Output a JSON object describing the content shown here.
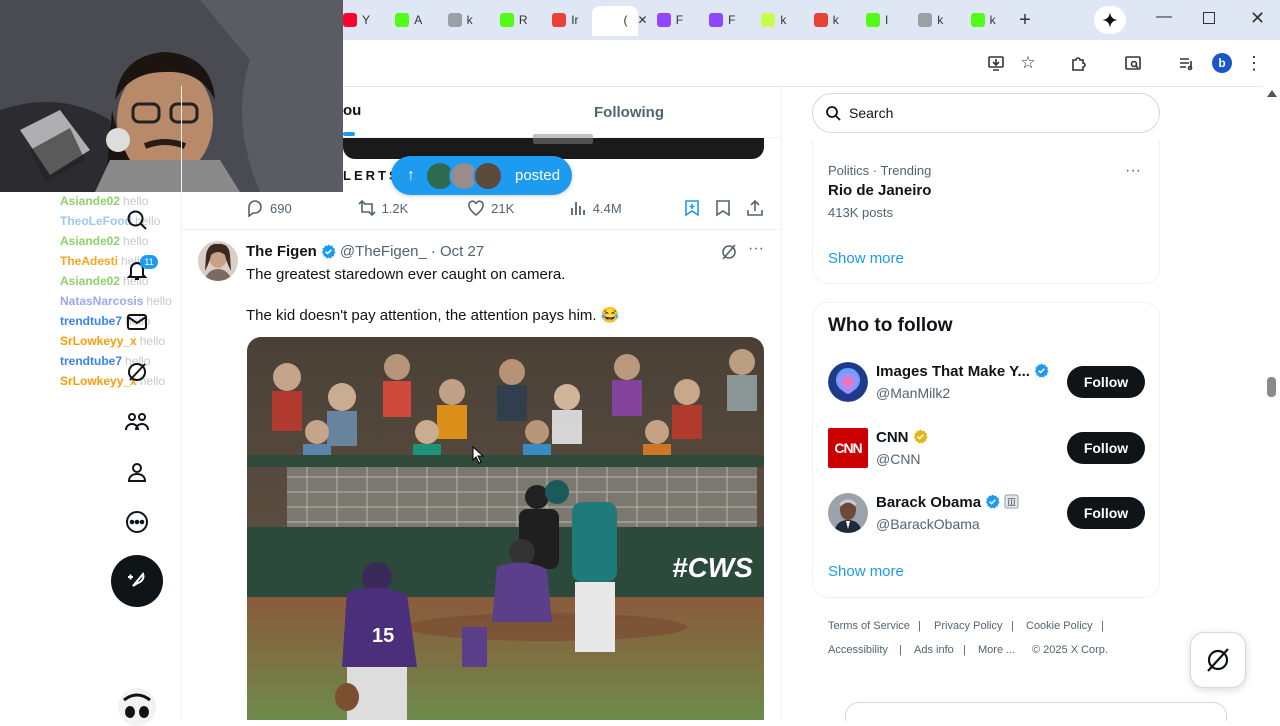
{
  "browser": {
    "tabs": [
      {
        "label": "Y",
        "color": "#ff0033"
      },
      {
        "label": "A",
        "color": "#53fc18"
      },
      {
        "label": "k",
        "color": "#9aa0a6"
      },
      {
        "label": "R",
        "color": "#53fc18"
      },
      {
        "label": "Ir",
        "color": "#ea4335"
      },
      {
        "label": "(",
        "color": "#ffffff"
      },
      {
        "label": "F",
        "color": "#9146ff"
      },
      {
        "label": "F",
        "color": "#9146ff"
      },
      {
        "label": "k",
        "color": "#c6ff4a"
      },
      {
        "label": "k",
        "color": "#ea4335"
      },
      {
        "label": "I",
        "color": "#53fc18"
      },
      {
        "label": "k",
        "color": "#9aa0a6"
      },
      {
        "label": "k",
        "color": "#53fc18"
      }
    ],
    "profile_initial": "b"
  },
  "chat": [
    {
      "user": "Asiande02",
      "color": "#8fd36b",
      "msg": "hello"
    },
    {
      "user": "TheoLeFood",
      "color": "#9fc6f5",
      "msg": "hello"
    },
    {
      "user": "Asiande02",
      "color": "#8fd36b",
      "msg": "hello"
    },
    {
      "user": "TheAdesti",
      "color": "#f5a623",
      "msg": "hello"
    },
    {
      "user": "Asiande02",
      "color": "#8fd36b",
      "msg": "hello"
    },
    {
      "user": "NatasNarcosis",
      "color": "#9fa7e8",
      "msg": "hello"
    },
    {
      "user": "trendtube7",
      "color": "#3b82f6",
      "msg": "hello"
    },
    {
      "user": "SrLowkeyy_x",
      "color": "#f59e0b",
      "msg": "hello"
    },
    {
      "user": "trendtube7",
      "color": "#3b82f6",
      "msg": "hello"
    },
    {
      "user": "SrLowkeyy_x",
      "color": "#f59e0b",
      "msg": "hello"
    }
  ],
  "sidebar": {
    "notif_count": "11"
  },
  "feed": {
    "tab_for_you": "ou",
    "tab_following": "Following",
    "alerts_fragment": "LERTS",
    "posted_pill": "posted"
  },
  "prev_tweet": {
    "replies": "690",
    "reposts": "1.2K",
    "likes": "21K",
    "views": "4.4M"
  },
  "tweet": {
    "name": "The Figen",
    "handle": "@TheFigen_",
    "date": "· Oct 27",
    "line1": "The greatest staredown ever caught on camera.",
    "line2": "The kid doesn't pay attention, the attention pays him. 😂",
    "media_overlay": "#CWS",
    "jersey": "15"
  },
  "right": {
    "search_placeholder": "Search",
    "trend": {
      "category": "Politics · Trending",
      "topic": "Rio de Janeiro",
      "posts": "413K posts"
    },
    "show_more": "Show more",
    "wtf_title": "Who to follow",
    "wtf": [
      {
        "name": "Images That Make Y...",
        "handle": "@ManMilk2",
        "follow": "Follow"
      },
      {
        "name": "CNN",
        "handle": "@CNN",
        "follow": "Follow",
        "logo": "CNN"
      },
      {
        "name": "Barack Obama",
        "handle": "@BarackObama",
        "follow": "Follow"
      }
    ],
    "wtf_show_more": "Show more",
    "footer": {
      "terms": "Terms of Service",
      "privacy": "Privacy Policy",
      "cookie": "Cookie Policy",
      "accessibility": "Accessibility",
      "ads": "Ads info",
      "more": "More ...",
      "copyright": "© 2025 X Corp."
    }
  },
  "colors": {
    "accent": "#1d9bf0",
    "dark": "#0f1419",
    "muted": "#536471"
  }
}
